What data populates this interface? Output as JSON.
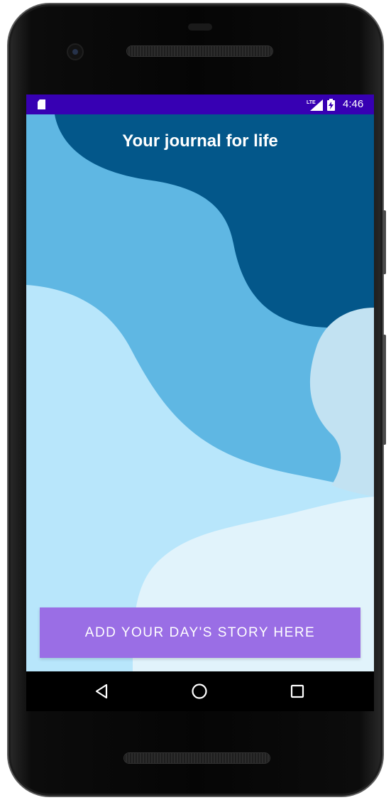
{
  "status_bar": {
    "time": "4:46",
    "network_label": "LTE",
    "background_color": "#3700b3",
    "icons": [
      "sd-card-icon",
      "lte-signal-icon",
      "battery-charging-icon"
    ]
  },
  "app": {
    "title": "Your journal for life",
    "primary_button_label": "ADD YOUR DAY'S STORY HERE",
    "accent_color": "#9a6ee5"
  },
  "background_palette": {
    "dark_blue": "#03578a",
    "medium_blue": "#5fb7e3",
    "light_blue": "#b8e6fb",
    "pale_blue": "#e1f3fb"
  },
  "navigation_bar": {
    "buttons": [
      "back-icon",
      "home-icon",
      "recents-icon"
    ]
  }
}
